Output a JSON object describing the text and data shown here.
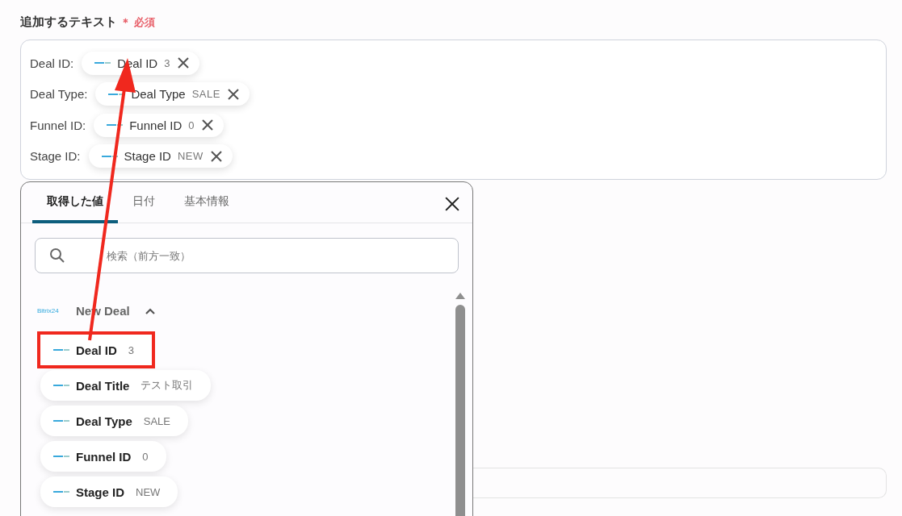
{
  "field": {
    "label": "追加するテキスト",
    "required_mark": "＊",
    "required_text": "必須",
    "rows": [
      {
        "label": "Deal ID:",
        "chip": {
          "name": "Deal ID",
          "value": "3"
        }
      },
      {
        "label": "Deal Type:",
        "chip": {
          "name": "Deal Type",
          "value": "SALE"
        }
      },
      {
        "label": "Funnel ID:",
        "chip": {
          "name": "Funnel ID",
          "value": "0"
        }
      },
      {
        "label": "Stage ID:",
        "chip": {
          "name": "Stage ID",
          "value": "NEW"
        }
      }
    ]
  },
  "popup": {
    "tabs": [
      {
        "label": "取得した値",
        "selected": true
      },
      {
        "label": "日付",
        "selected": false
      },
      {
        "label": "基本情報",
        "selected": false
      }
    ],
    "search": {
      "placeholder": "検索（前方一致）"
    },
    "group": {
      "logo": "Bitrix24",
      "title": "New Deal",
      "expanded": true,
      "items": [
        {
          "name": "Deal ID",
          "value": "3",
          "highlighted": true
        },
        {
          "name": "Deal Title",
          "value": "テスト取引",
          "highlighted": false
        },
        {
          "name": "Deal Type",
          "value": "SALE",
          "highlighted": false
        },
        {
          "name": "Funnel ID",
          "value": "0",
          "highlighted": false
        },
        {
          "name": "Stage ID",
          "value": "NEW",
          "highlighted": false
        }
      ]
    }
  }
}
